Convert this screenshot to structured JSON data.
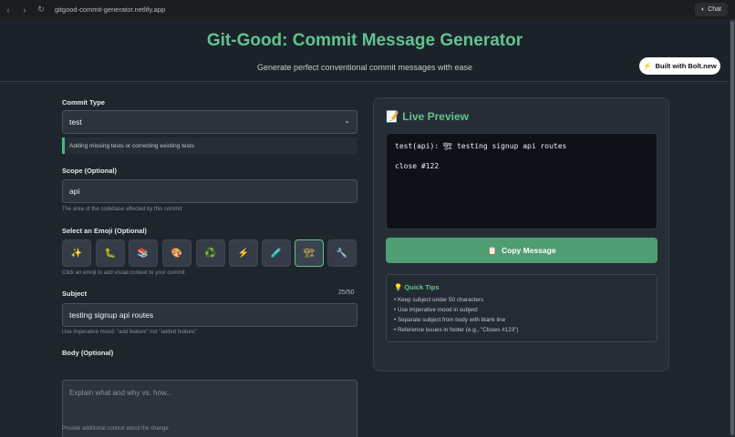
{
  "browser": {
    "url": "gitgood-commit-generator.netlify.app",
    "chat_label": "Chat"
  },
  "header": {
    "title": "Git-Good: Commit Message Generator",
    "subtitle": "Generate perfect conventional commit messages with ease",
    "bolt_label": "Built with Bolt.new"
  },
  "form": {
    "commit_type_label": "Commit Type",
    "commit_type_value": "test",
    "commit_type_description": "Adding missing tests or correcting existing tests",
    "scope_label": "Scope (Optional)",
    "scope_value": "api",
    "scope_hint": "The area of the codebase affected by this commit",
    "emoji_label": "Select an Emoji (Optional)",
    "emojis": [
      "✨",
      "🐛",
      "📚",
      "🎨",
      "♻️",
      "⚡",
      "🧪",
      "🏗",
      "🔧"
    ],
    "emoji_hint": "Click an emoji to add visual context to your commit",
    "subject_label": "Subject",
    "subject_counter": "25/50",
    "subject_value": "testing signup api routes",
    "subject_hint": "Use imperative mood: \"add feature\" not \"added feature\"",
    "body_label": "Body (Optional)",
    "body_placeholder": "Explain what and why vs. how...",
    "body_hint": "Provide additional context about the change"
  },
  "preview": {
    "title": "📝 Live Preview",
    "line1": "test(api): 🏗 testing signup api routes",
    "line2": "",
    "line3": "close #122",
    "copy_label": "Copy Message"
  },
  "tips": {
    "title": "Quick Tips",
    "items": [
      "• Keep subject under 50 characters",
      "• Use imperative mood in subject",
      "• Separate subject from body with blank line",
      "• Reference issues in footer (e.g., \"Closes #123\")"
    ]
  }
}
